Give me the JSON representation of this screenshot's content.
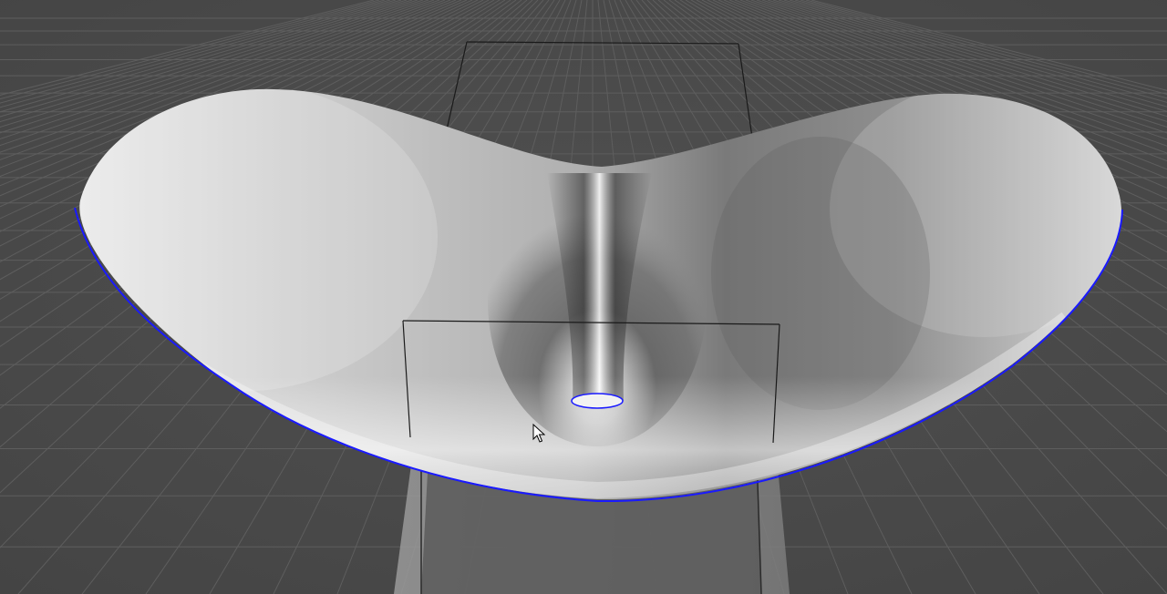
{
  "viewport": {
    "background_color": "#4a4a4a",
    "grid_color": "#5e5e5e",
    "mesh_highlight": "#f4f4f4",
    "mesh_shadow": "#3a3a3a",
    "border_edge_color": "#1a1aff",
    "bounding_box_color": "#1a1a1a",
    "pedestal_color": "#8c8c8c"
  },
  "objects": [
    {
      "kind": "surface-mesh",
      "name": "saddle-surface",
      "selected_edges": "border"
    },
    {
      "kind": "bounding-box",
      "name": "manipulator-box"
    },
    {
      "kind": "hole",
      "name": "center-hole"
    }
  ],
  "cursor": {
    "icon": "arrow-cursor-icon"
  }
}
